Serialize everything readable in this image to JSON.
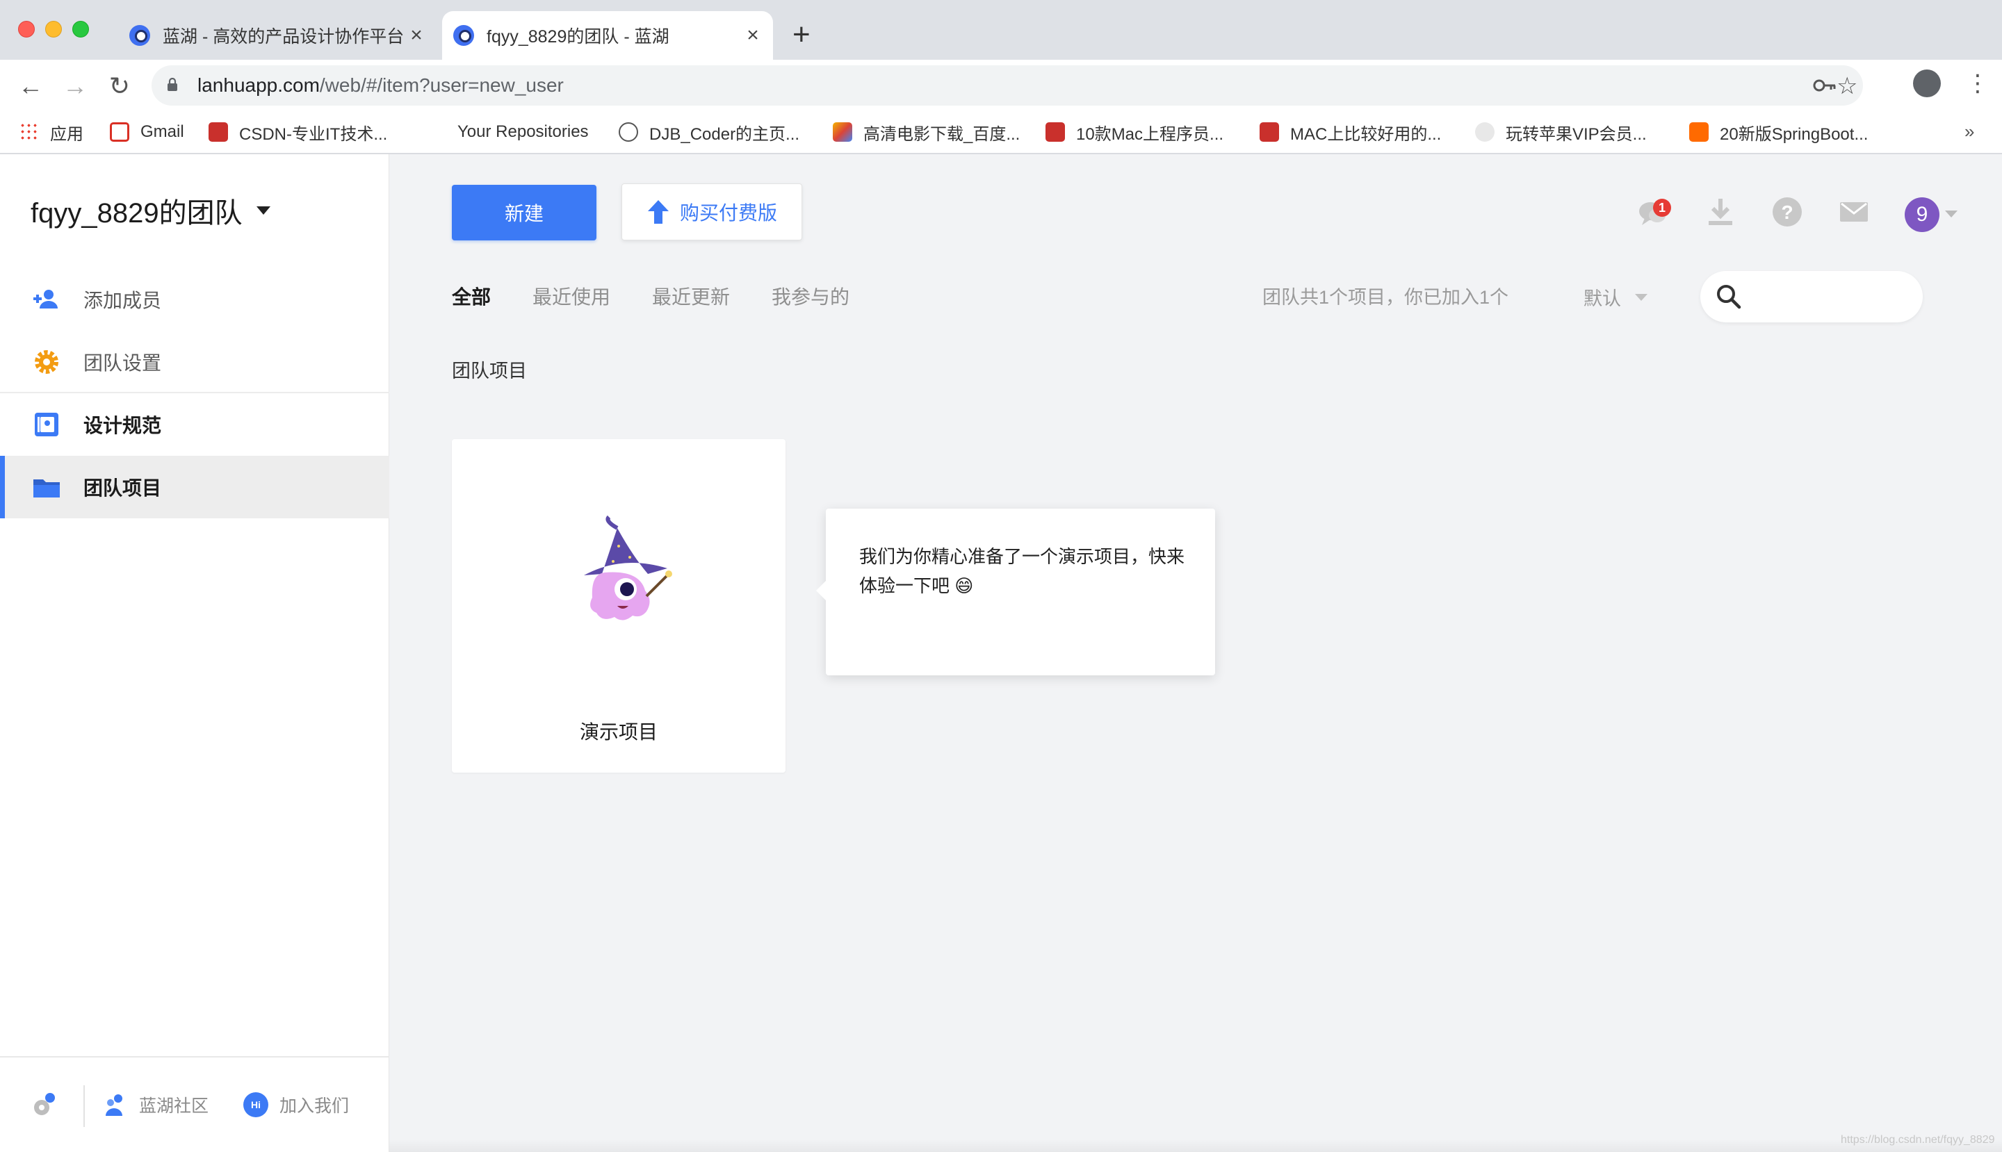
{
  "browser": {
    "tabs": [
      {
        "title": "蓝湖 - 高效的产品设计协作平台",
        "active": false
      },
      {
        "title": "fqyy_8829的团队 - 蓝湖",
        "active": true
      }
    ],
    "url_host": "lanhuapp.com",
    "url_path": "/web/#/item?user=new_user",
    "bookmarks": [
      {
        "label": "应用",
        "icon": "apps-grid-icon"
      },
      {
        "label": "Gmail",
        "icon": "gmail-icon"
      },
      {
        "label": "CSDN-专业IT技术...",
        "icon": "csdn-icon"
      },
      {
        "label": "Your Repositories",
        "icon": "github-icon"
      },
      {
        "label": "DJB_Coder的主页...",
        "icon": "profile-icon"
      },
      {
        "label": "高清电影下载_百度...",
        "icon": "movie-icon"
      },
      {
        "label": "10款Mac上程序员...",
        "icon": "csdn-icon"
      },
      {
        "label": "MAC上比较好用的...",
        "icon": "csdn-icon"
      },
      {
        "label": "玩转苹果VIP会员...",
        "icon": "apple-icon"
      },
      {
        "label": "20新版SpringBoot...",
        "icon": "taobao-icon"
      }
    ],
    "bookmarks_more": "»"
  },
  "sidebar": {
    "team_name": "fqyy_8829的团队",
    "items": [
      {
        "label": "添加成员",
        "icon": "add-member-icon"
      },
      {
        "label": "团队设置",
        "icon": "gear-icon"
      },
      {
        "label": "设计规范",
        "icon": "design-spec-icon"
      },
      {
        "label": "团队项目",
        "icon": "folder-icon",
        "selected": true
      }
    ],
    "footer": {
      "community": "蓝湖社区",
      "join": "加入我们",
      "join_badge": "Hi"
    }
  },
  "toolbar": {
    "new_label": "新建",
    "buy_label": "购买付费版",
    "notification_count": "1",
    "avatar_initial": "9"
  },
  "filters": {
    "tabs": [
      "全部",
      "最近使用",
      "最近更新",
      "我参与的"
    ],
    "active_tab": "全部",
    "summary": "团队共1个项目，你已加入1个",
    "sort_label": "默认",
    "search_placeholder": ""
  },
  "section_title": "团队项目",
  "projects": [
    {
      "name": "演示项目"
    }
  ],
  "tip": {
    "text": "我们为你精心准备了一个演示项目，快来体验一下吧 😄"
  },
  "watermark": "https://blog.csdn.net/fqyy_8829",
  "colors": {
    "accent": "#3c7af5",
    "badge": "#e63b35",
    "avatar": "#7e57c2",
    "settings_orange": "#f39c12"
  }
}
